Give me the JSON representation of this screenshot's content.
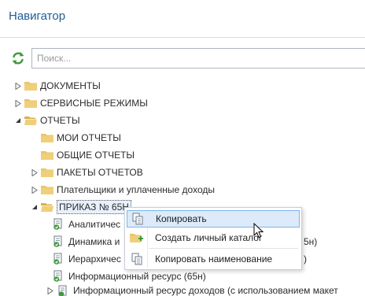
{
  "header": {
    "title": "Навигатор"
  },
  "toolbar": {
    "refresh_icon": "refresh-icon",
    "search_placeholder": "Поиск..."
  },
  "tree": {
    "nodes": [
      {
        "label": "ДОКУМЕНТЫ",
        "state": "collapsed"
      },
      {
        "label": "СЕРВИСНЫЕ РЕЖИМЫ",
        "state": "collapsed"
      },
      {
        "label": "ОТЧЕТЫ",
        "state": "expanded"
      },
      {
        "label": "МОИ ОТЧЕТЫ",
        "state": "leaf"
      },
      {
        "label": "ОБЩИЕ ОТЧЕТЫ",
        "state": "leaf"
      },
      {
        "label": "ПАКЕТЫ ОТЧЕТОВ",
        "state": "collapsed"
      },
      {
        "label": "Плательщики и уплаченные доходы",
        "state": "collapsed"
      },
      {
        "label": "ПРИКАЗ № 65Н",
        "state": "expanded",
        "selected": true
      },
      {
        "label": "Аналитичес",
        "state": "report"
      },
      {
        "label": "Динамика и",
        "state": "report"
      },
      {
        "label": "Иерархичес",
        "state": "report"
      },
      {
        "label": "Информационный ресурс (65н)",
        "state": "report"
      },
      {
        "label": "Информационный ресурс доходов (с использованием макет",
        "state": "report"
      }
    ],
    "partial_text": {
      "dinamika_tail": "5н)",
      "ierarh_tail": ")"
    }
  },
  "context_menu": {
    "items": [
      {
        "label": "Копировать",
        "icon": "copy-icon",
        "highlighted": true
      },
      {
        "label": "Создать личный каталог",
        "icon": "new-folder-icon"
      },
      {
        "label": "Копировать наименование",
        "icon": "copy-name-icon"
      }
    ]
  },
  "colors": {
    "title": "#1f5c94",
    "folder": "#e8c56a",
    "menu_highlight": "#dceafa",
    "menu_highlight_border": "#7eb4ea",
    "refresh_icon": "#3e9a3a"
  }
}
